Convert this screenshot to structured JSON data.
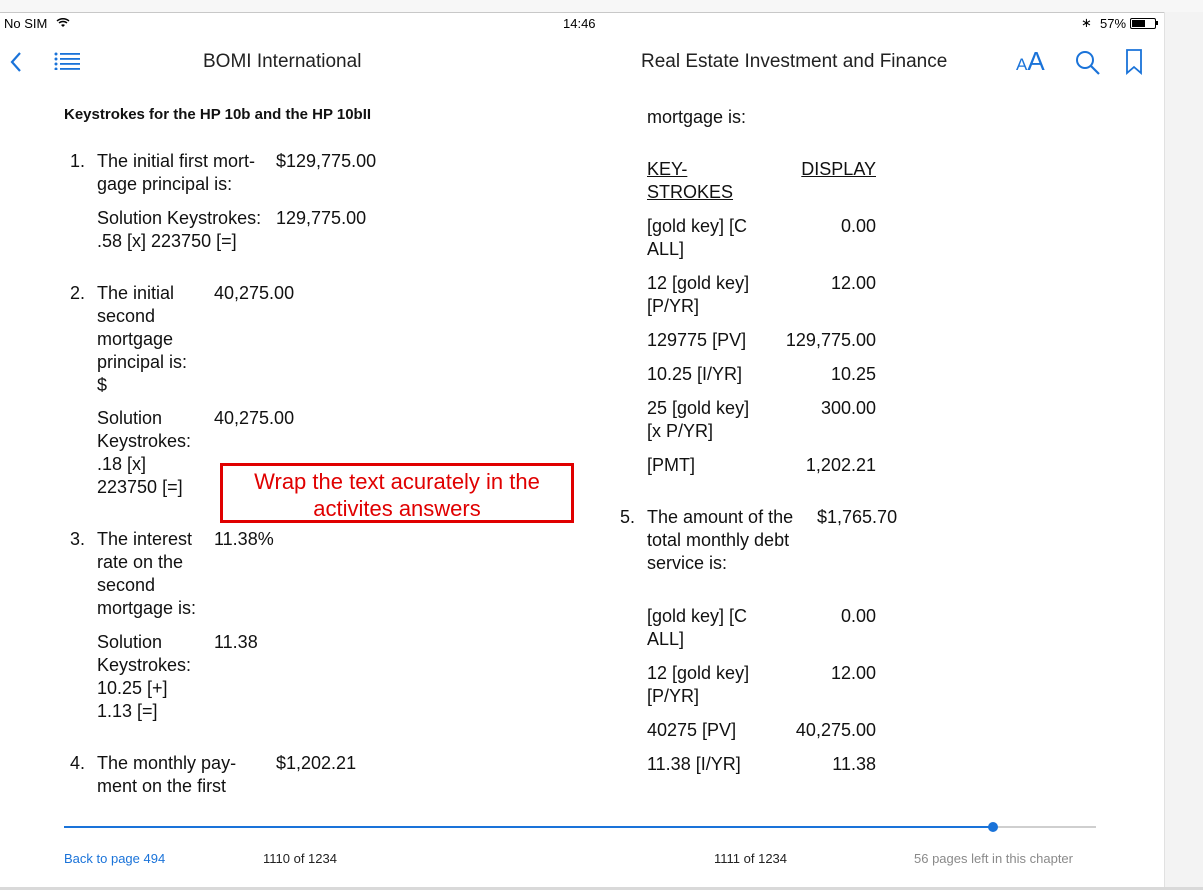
{
  "status": {
    "carrier": "No SIM",
    "time": "14:46",
    "battery": "57%"
  },
  "toolbar": {
    "left_title": "BOMI International",
    "right_title": "Real Estate Investment and Finance",
    "font_label": "AA"
  },
  "page_left": {
    "heading": "Keystrokes for the HP 10b and the HP 10bII",
    "items": [
      {
        "num": "1.",
        "q1": "The initial first mort-",
        "q2": "gage principal is:",
        "ans": "$129,775.00",
        "sol1": "Solution Keystrokes:",
        "sol2": ".58 [x] 223750 [=]",
        "sol_val": "129,775.00"
      },
      {
        "num": "2.",
        "q1": "The initial",
        "q2": "second",
        "q3": "mortgage",
        "q4": "principal is:",
        "q5": "$",
        "ans": "40,275.00",
        "sol1": "Solution",
        "sol2": "Keystrokes:",
        "sol3": ".18 [x]",
        "sol4": "223750 [=]",
        "sol_val": "40,275.00"
      },
      {
        "num": "3.",
        "q1": "The interest",
        "q2": "rate on the",
        "q3": "second",
        "q4": "mortgage is:",
        "ans": "11.38%",
        "sol1": "Solution",
        "sol2": "Keystrokes:",
        "sol3": "10.25 [+]",
        "sol4": "1.13 [=]",
        "sol_val": "11.38"
      },
      {
        "num": "4.",
        "q1": "The monthly pay-",
        "q2": "ment on the first",
        "ans": "$1,202.21"
      }
    ]
  },
  "page_right": {
    "cont": "mortgage is:",
    "head_keys_1": "KEY-",
    "head_keys_2": "STROKES",
    "head_display": "DISPLAY",
    "rows_a": [
      {
        "k1": "[gold key] [C",
        "k2": "ALL]",
        "v": "0.00"
      },
      {
        "k1": "12 [gold key]",
        "k2": "[P/YR]",
        "v": "12.00"
      },
      {
        "k1": "129775 [PV]",
        "v": "129,775.00"
      },
      {
        "k1": "10.25 [I/YR]",
        "v": "10.25"
      },
      {
        "k1": "25 [gold key]",
        "k2": "[x P/YR]",
        "v": "300.00"
      },
      {
        "k1": "[PMT]",
        "v": "1,202.21"
      }
    ],
    "item5": {
      "num": "5.",
      "q1": "The amount of the",
      "q2": "total monthly debt",
      "q3": "service is:",
      "ans": "$1,765.70"
    },
    "rows_b": [
      {
        "k1": "[gold key] [C",
        "k2": "ALL]",
        "v": "0.00"
      },
      {
        "k1": "12 [gold key]",
        "k2": "[P/YR]",
        "v": "12.00"
      },
      {
        "k1": "40275 [PV]",
        "v": "40,275.00"
      },
      {
        "k1": "11.38 [I/YR]",
        "v": "11.38"
      }
    ]
  },
  "annotation": {
    "line1": "Wrap the text acurately in the",
    "line2": "activites answers"
  },
  "footer": {
    "back": "Back to page 494",
    "left_page": "1110 of 1234",
    "right_page": "1111 of 1234",
    "remaining": "56 pages left in this chapter"
  },
  "progress": {
    "fraction": 0.9
  }
}
